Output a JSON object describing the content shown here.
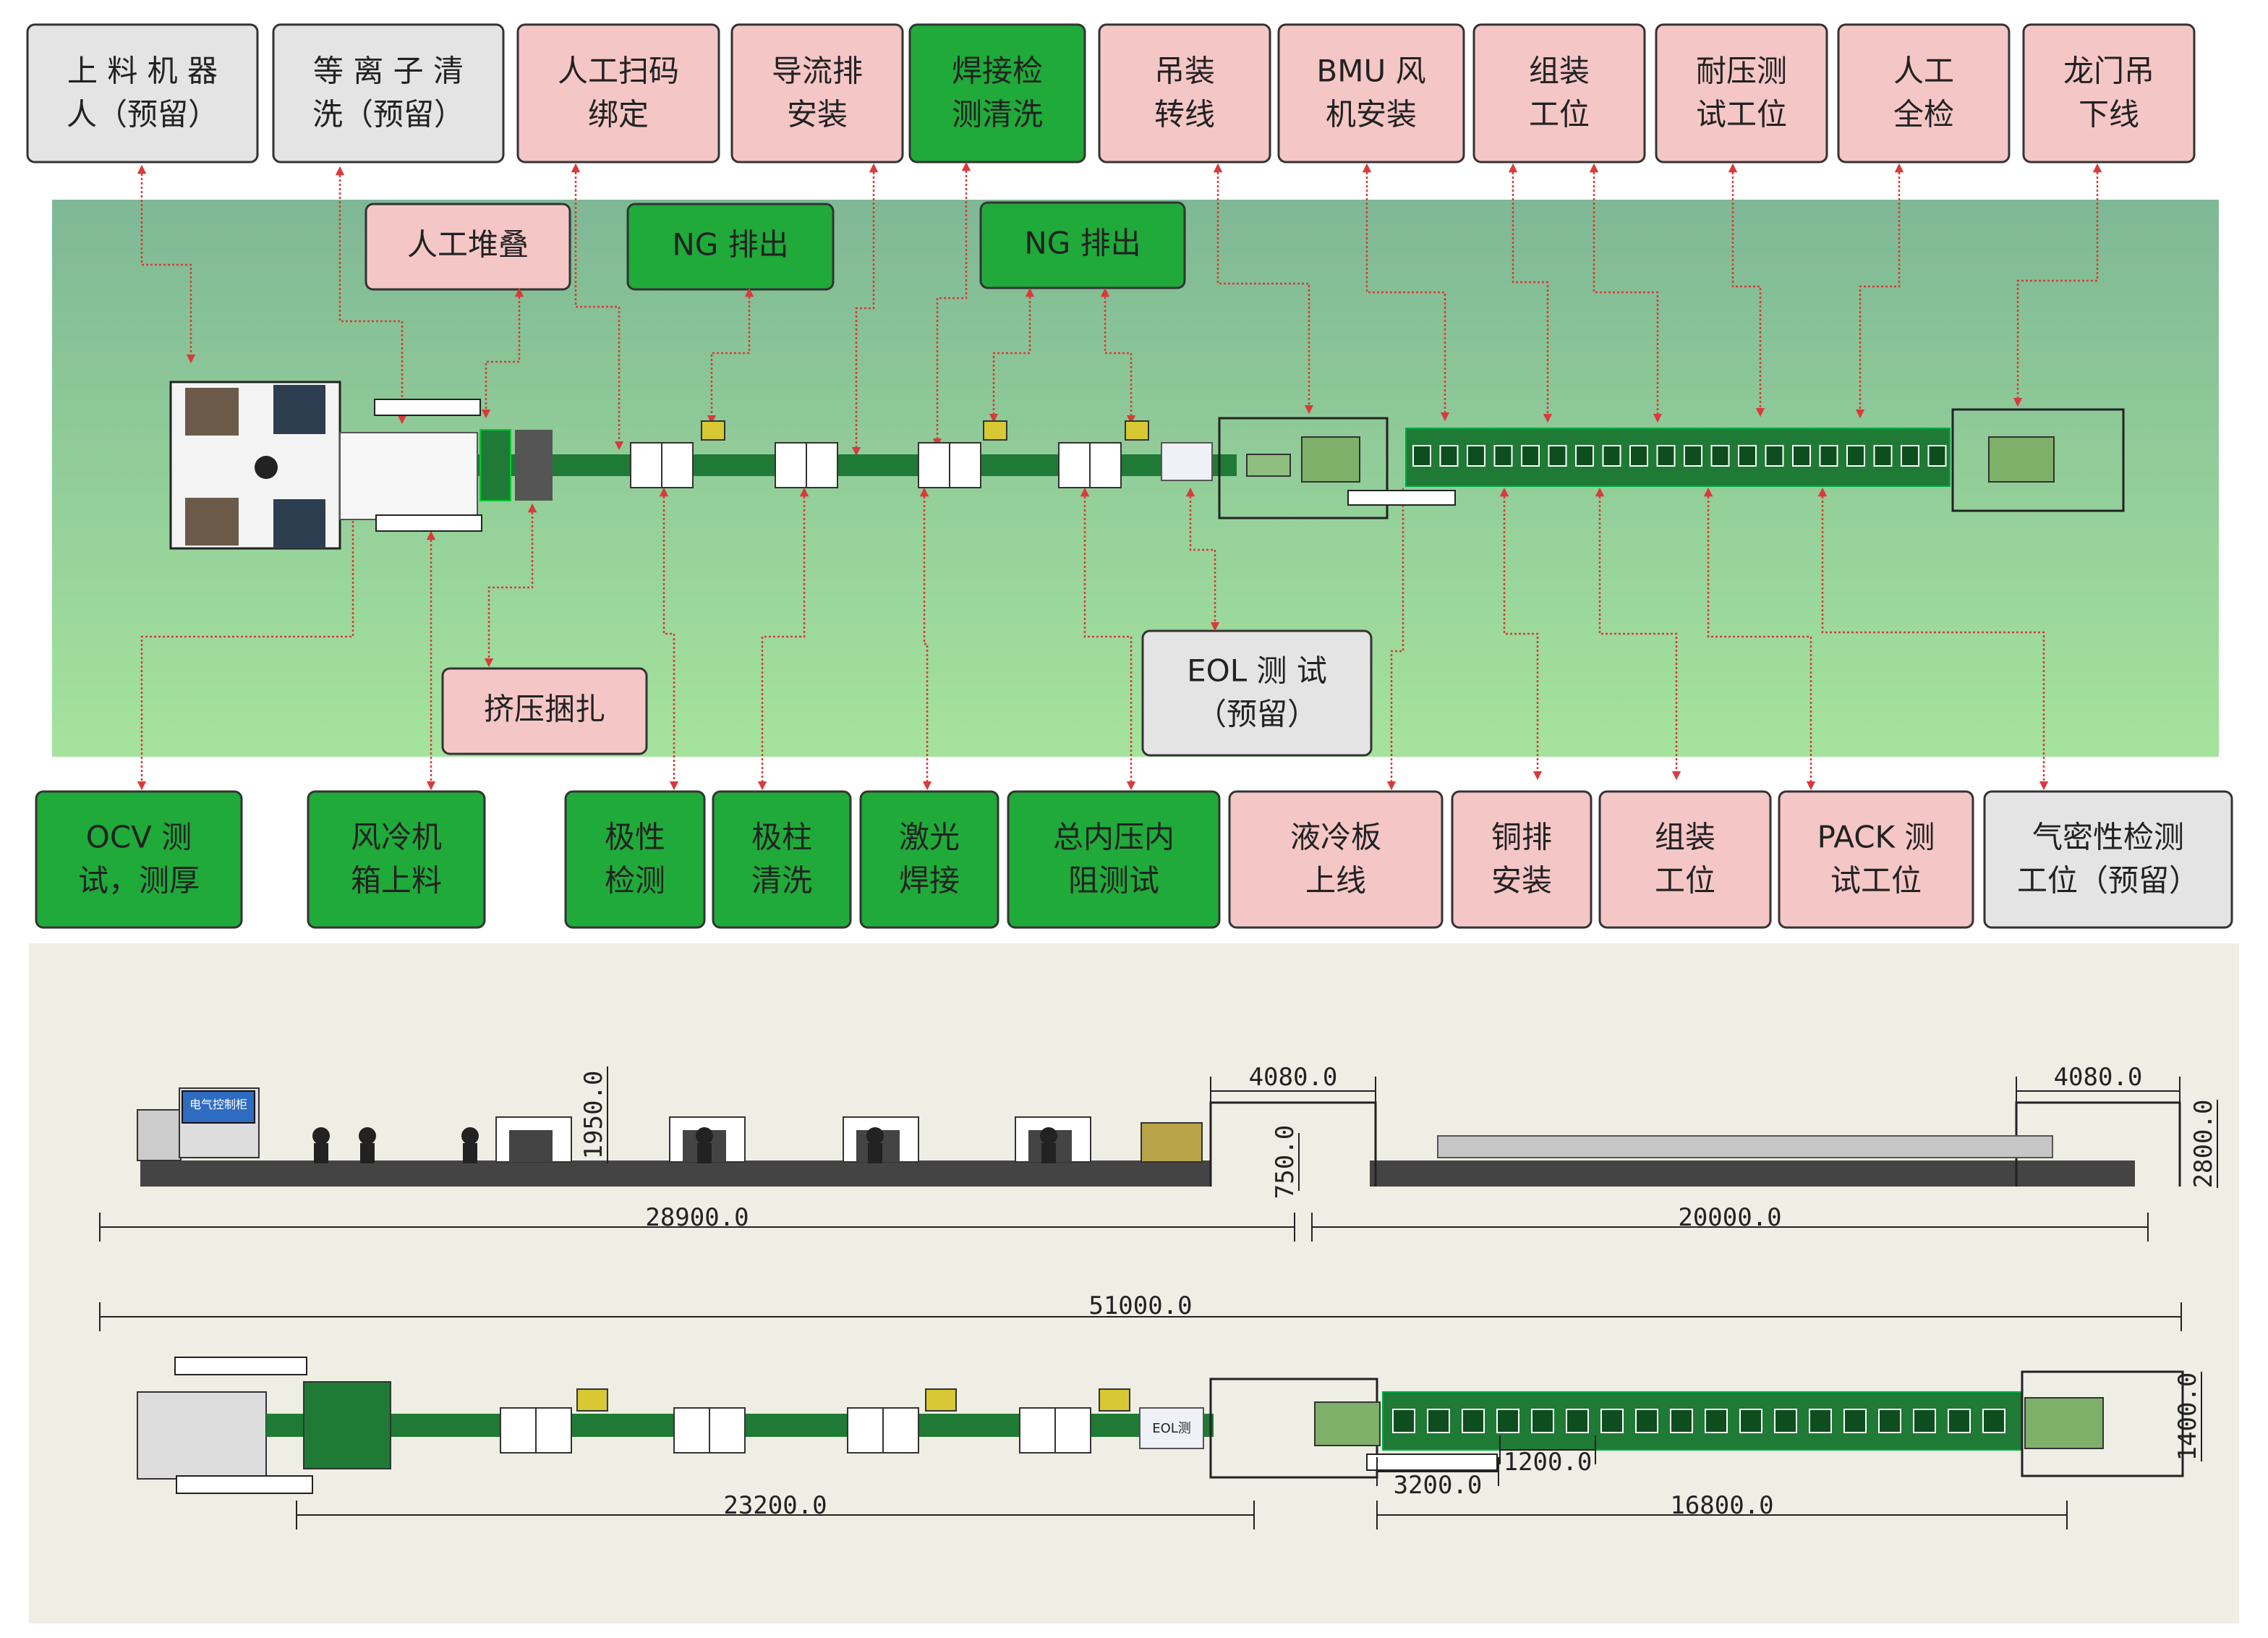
{
  "colors": {
    "pink": "#f4c6c6",
    "green": "#1faa3a",
    "gray": "#e4e4e4",
    "boxBorder": "#333333",
    "arrow": "#d93a3a",
    "bgTop": "#7fb895",
    "bgBottom": "#a5e39d",
    "drawingBg": "#eeeee4",
    "conveyor": "#1e7a34"
  },
  "top_labels": [
    {
      "line1": "上 料 机 器",
      "line2": "人（预留）",
      "kind": "gray"
    },
    {
      "line1": "等 离 子 清",
      "line2": "洗（预留）",
      "kind": "gray"
    },
    {
      "line1": "人工扫码",
      "line2": "绑定",
      "kind": "pink"
    },
    {
      "line1": "导流排",
      "line2": "安装",
      "kind": "pink"
    },
    {
      "line1": "焊接检",
      "line2": "测清洗",
      "kind": "green"
    },
    {
      "line1": "吊装",
      "line2": "转线",
      "kind": "pink"
    },
    {
      "line1": "BMU 风",
      "line2": "机安装",
      "kind": "pink"
    },
    {
      "line1": "组装",
      "line2": "工位",
      "kind": "pink"
    },
    {
      "line1": "耐压测",
      "line2": "试工位",
      "kind": "pink"
    },
    {
      "line1": "人工",
      "line2": "全检",
      "kind": "pink"
    },
    {
      "line1": "龙门吊",
      "line2": "下线",
      "kind": "pink"
    }
  ],
  "middle_labels": [
    {
      "line1": "人工堆叠",
      "kind": "pink"
    },
    {
      "line1": "NG 排出",
      "kind": "green"
    },
    {
      "line1": "NG 排出",
      "kind": "green"
    },
    {
      "line1": "挤压捆扎",
      "kind": "pink"
    },
    {
      "line1": "EOL  测  试",
      "line2": "（预留）",
      "kind": "gray"
    }
  ],
  "bottom_labels": [
    {
      "line1": "OCV 测",
      "line2": "试，测厚",
      "kind": "green"
    },
    {
      "line1": "风冷机",
      "line2": "箱上料",
      "kind": "green"
    },
    {
      "line1": "极性",
      "line2": "检测",
      "kind": "green"
    },
    {
      "line1": "极柱",
      "line2": "清洗",
      "kind": "green"
    },
    {
      "line1": "激光",
      "line2": "焊接",
      "kind": "green"
    },
    {
      "line1": "总内压内",
      "line2": "阻测试",
      "kind": "green"
    },
    {
      "line1": "液冷板",
      "line2": "上线",
      "kind": "pink"
    },
    {
      "line1": "铜排",
      "line2": "安装",
      "kind": "pink"
    },
    {
      "line1": "组装",
      "line2": "工位",
      "kind": "pink"
    },
    {
      "line1": "PACK 测",
      "line2": "试工位",
      "kind": "pink"
    },
    {
      "line1": "气密性检测",
      "line2": "工位（预留）",
      "kind": "gray"
    }
  ],
  "dimensions": {
    "side_height_left": "1950.0",
    "side_small": "750.0",
    "side_gantry_left_width": "4080.0",
    "side_gantry_right_width": "4080.0",
    "side_height_right": "2800.0",
    "side_length_left": "28900.0",
    "side_length_right": "20000.0",
    "total_length": "51000.0",
    "plan_length_left": "23200.0",
    "plan_spacing": "1200.0",
    "plan_first": "3200.0",
    "plan_length_right": "16800.0",
    "plan_width": "1400.0"
  },
  "equipment_text": {
    "side_screen": "电气控制柜",
    "plan_eol": "EOL测"
  }
}
